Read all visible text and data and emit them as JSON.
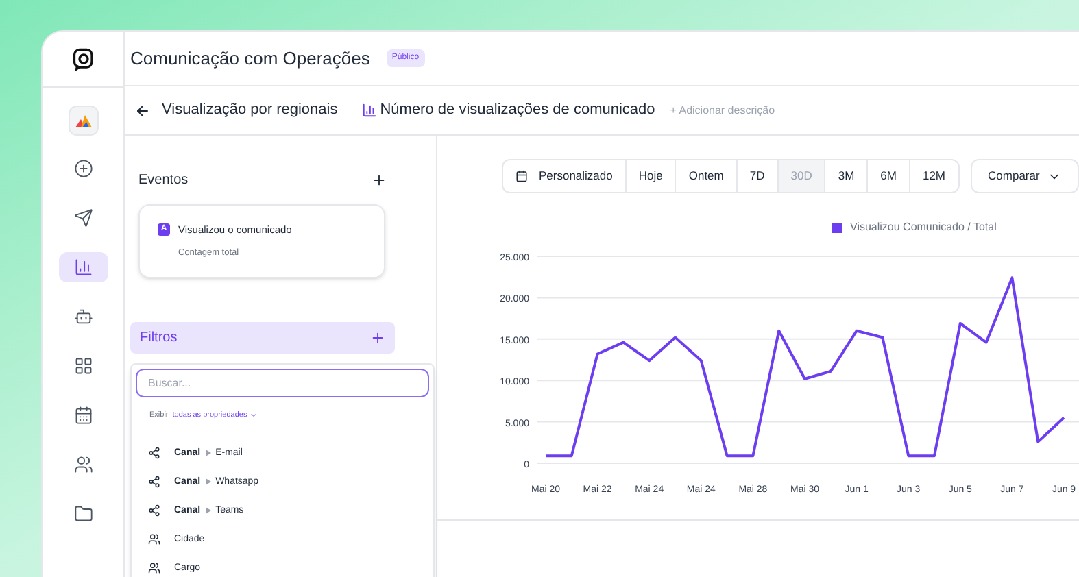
{
  "header": {
    "title": "Comunicação com Operações",
    "badge": "Público"
  },
  "rail": {
    "items": [
      {
        "selected": false
      },
      {
        "selected": false
      },
      {
        "selected": true
      },
      {
        "selected": false
      },
      {
        "selected": false
      },
      {
        "selected": false
      },
      {
        "selected": false
      },
      {
        "selected": false
      }
    ]
  },
  "breadcrumb": {
    "back_title": "Visualização por regionais",
    "report_title": "Número de visualizações de comunicado",
    "add_description": "+ Adicionar descrição"
  },
  "events": {
    "title": "Eventos",
    "items": [
      {
        "badge": "A",
        "name": "Visualizou o comunicado",
        "measure": "Contagem total"
      }
    ]
  },
  "filters": {
    "title": "Filtros",
    "search": {
      "placeholder": "Buscar..."
    },
    "show_label": "Exibir",
    "show_value": "todas as propriedades",
    "properties": [
      {
        "kind": "channel",
        "name": "Canal",
        "value": "E-mail"
      },
      {
        "kind": "channel",
        "name": "Canal",
        "value": "Whatsapp"
      },
      {
        "kind": "channel",
        "name": "Canal",
        "value": "Teams"
      },
      {
        "kind": "group",
        "name": "Cidade"
      },
      {
        "kind": "group",
        "name": "Cargo"
      }
    ]
  },
  "ranges": [
    {
      "label": "Personalizado",
      "kind": "custom",
      "selected": false
    },
    {
      "label": "Hoje",
      "kind": "preset",
      "selected": false
    },
    {
      "label": "Ontem",
      "kind": "preset",
      "selected": false
    },
    {
      "label": "7D",
      "kind": "preset",
      "selected": false
    },
    {
      "label": "30D",
      "kind": "preset",
      "selected": true
    },
    {
      "label": "3M",
      "kind": "preset",
      "selected": false
    },
    {
      "label": "6M",
      "kind": "preset",
      "selected": false
    },
    {
      "label": "12M",
      "kind": "preset",
      "selected": false
    }
  ],
  "compare": {
    "label": "Comparar"
  },
  "chart_data": {
    "type": "line",
    "grid": true,
    "categories": [
      "Mai 20",
      null,
      "Mai 22",
      null,
      "Mai 24",
      null,
      "Mai 24",
      null,
      "Mai 28",
      null,
      "Mai 30",
      null,
      "Jun 1",
      null,
      "Jun 3",
      null,
      "Jun 5",
      null,
      "Jun 7",
      null,
      "Jun 9"
    ],
    "series": [
      {
        "name": "Visualizou Comunicado / Total",
        "color": "#6d3ef0",
        "values": [
          900,
          900,
          13200,
          14600,
          12400,
          15200,
          12400,
          900,
          900,
          16000,
          10200,
          11100,
          16000,
          15200,
          900,
          900,
          16900,
          14600,
          22400,
          2600,
          5500
        ]
      }
    ],
    "ylim": [
      0,
      25000
    ],
    "yticks": [
      {
        "value": 0,
        "label": "0"
      },
      {
        "value": 5000,
        "label": "5.000"
      },
      {
        "value": 10000,
        "label": "10.000"
      },
      {
        "value": 15000,
        "label": "15.000"
      },
      {
        "value": 20000,
        "label": "20.000"
      },
      {
        "value": 25000,
        "label": "25.000"
      }
    ]
  }
}
